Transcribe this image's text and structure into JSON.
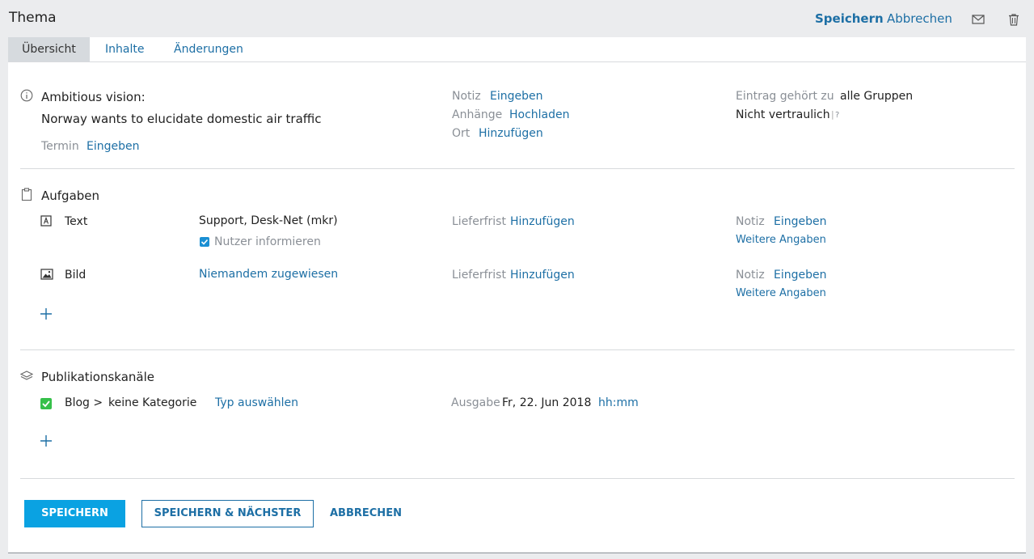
{
  "header": {
    "title": "Thema",
    "save_label": "Speichern",
    "cancel_label": "Abbrechen"
  },
  "tabs": [
    {
      "label": "Übersicht",
      "active": true
    },
    {
      "label": "Inhalte",
      "active": false
    },
    {
      "label": "Änderungen",
      "active": false
    }
  ],
  "overview": {
    "title": "Ambitious vision:",
    "subtitle": "Norway wants to elucidate domestic air traffic",
    "termin_label": "Termin",
    "termin_action": "Eingeben",
    "notiz_label": "Notiz",
    "notiz_action": "Eingeben",
    "anhaenge_label": "Anhänge",
    "anhaenge_action": "Hochladen",
    "ort_label": "Ort",
    "ort_action": "Hinzufügen",
    "eintrag_label": "Eintrag gehört zu",
    "eintrag_value": "alle Gruppen",
    "confidential": "Nicht vertraulich",
    "help_mark": "?"
  },
  "tasks": {
    "heading": "Aufgaben",
    "items": [
      {
        "type": "Text",
        "assignee": "Support, Desk-Net (mkr)",
        "notify_label": "Nutzer informieren",
        "notify_checked": true,
        "deadline_label": "Lieferfrist",
        "deadline_action": "Hinzufügen",
        "note_label": "Notiz",
        "note_action": "Eingeben",
        "more_label": "Weitere Angaben"
      },
      {
        "type": "Bild",
        "assignee": "Niemandem zugewiesen",
        "deadline_label": "Lieferfrist",
        "deadline_action": "Hinzufügen",
        "note_label": "Notiz",
        "note_action": "Eingeben",
        "more_label": "Weitere Angaben"
      }
    ]
  },
  "channels": {
    "heading": "Publikationskanäle",
    "items": [
      {
        "checked": true,
        "channel": "Blog >",
        "category": "keine Kategorie",
        "type_action": "Typ auswählen",
        "edition_label": "Ausgabe",
        "edition_date": "Fr, 22. Jun 2018",
        "time_placeholder": "hh:mm"
      }
    ]
  },
  "footer": {
    "save": "SPEICHERN",
    "save_next": "SPEICHERN & NÄCHSTER",
    "cancel": "ABBRECHEN"
  },
  "colors": {
    "link": "#1d6fa5",
    "primary_button": "#0aa2e2",
    "checkbox_blue": "#1a8fd3",
    "checkbox_green": "#36c04a"
  }
}
